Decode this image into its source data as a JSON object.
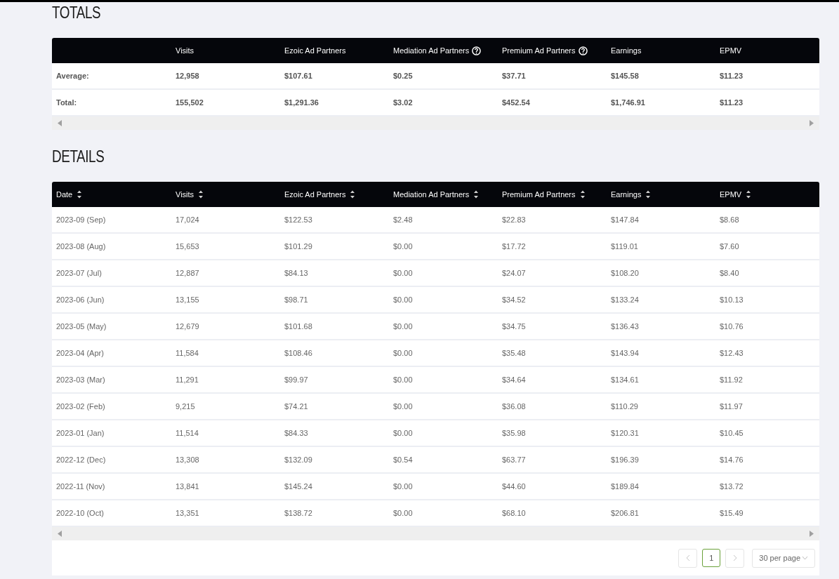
{
  "totals": {
    "title": "TOTALS",
    "columns": [
      {
        "help": false
      },
      {
        "label": "Visits",
        "help": false
      },
      {
        "label": "Ezoic Ad Partners",
        "help": false
      },
      {
        "label": "Mediation Ad Partners",
        "help": true
      },
      {
        "label": "Premium Ad Partners",
        "help": true
      },
      {
        "label": "Earnings",
        "help": false
      },
      {
        "label": "EPMV",
        "help": false
      }
    ],
    "rows": [
      [
        "Average:",
        "12,958",
        "$107.61",
        "$0.25",
        "$37.71",
        "$145.58",
        "$11.23"
      ],
      [
        "Total:",
        "155,502",
        "$1,291.36",
        "$3.02",
        "$452.54",
        "$1,746.91",
        "$11.23"
      ]
    ]
  },
  "details": {
    "title": "DETAILS",
    "columns": [
      {
        "label": "Date",
        "sortable": true
      },
      {
        "label": "Visits",
        "sortable": true
      },
      {
        "label": "Ezoic Ad Partners",
        "sortable": true
      },
      {
        "label": "Mediation Ad Partners",
        "sortable": true
      },
      {
        "label": "Premium Ad Partners",
        "sortable": true
      },
      {
        "label": "Earnings",
        "sortable": true
      },
      {
        "label": "EPMV",
        "sortable": true
      }
    ],
    "rows": [
      [
        "2023-09 (Sep)",
        "17,024",
        "$122.53",
        "$2.48",
        "$22.83",
        "$147.84",
        "$8.68"
      ],
      [
        "2023-08 (Aug)",
        "15,653",
        "$101.29",
        "$0.00",
        "$17.72",
        "$119.01",
        "$7.60"
      ],
      [
        "2023-07 (Jul)",
        "12,887",
        "$84.13",
        "$0.00",
        "$24.07",
        "$108.20",
        "$8.40"
      ],
      [
        "2023-06 (Jun)",
        "13,155",
        "$98.71",
        "$0.00",
        "$34.52",
        "$133.24",
        "$10.13"
      ],
      [
        "2023-05 (May)",
        "12,679",
        "$101.68",
        "$0.00",
        "$34.75",
        "$136.43",
        "$10.76"
      ],
      [
        "2023-04 (Apr)",
        "11,584",
        "$108.46",
        "$0.00",
        "$35.48",
        "$143.94",
        "$12.43"
      ],
      [
        "2023-03 (Mar)",
        "11,291",
        "$99.97",
        "$0.00",
        "$34.64",
        "$134.61",
        "$11.92"
      ],
      [
        "2023-02 (Feb)",
        "9,215",
        "$74.21",
        "$0.00",
        "$36.08",
        "$110.29",
        "$11.97"
      ],
      [
        "2023-01 (Jan)",
        "11,514",
        "$84.33",
        "$0.00",
        "$35.98",
        "$120.31",
        "$10.45"
      ],
      [
        "2022-12 (Dec)",
        "13,308",
        "$132.09",
        "$0.54",
        "$63.77",
        "$196.39",
        "$14.76"
      ],
      [
        "2022-11 (Nov)",
        "13,841",
        "$145.24",
        "$0.00",
        "$44.60",
        "$189.84",
        "$13.72"
      ],
      [
        "2022-10 (Oct)",
        "13,351",
        "$138.72",
        "$0.00",
        "$68.10",
        "$206.81",
        "$15.49"
      ]
    ],
    "pagination": {
      "pages": [
        {
          "label": "1",
          "selected": true
        }
      ],
      "per_page": "30 per page"
    }
  }
}
